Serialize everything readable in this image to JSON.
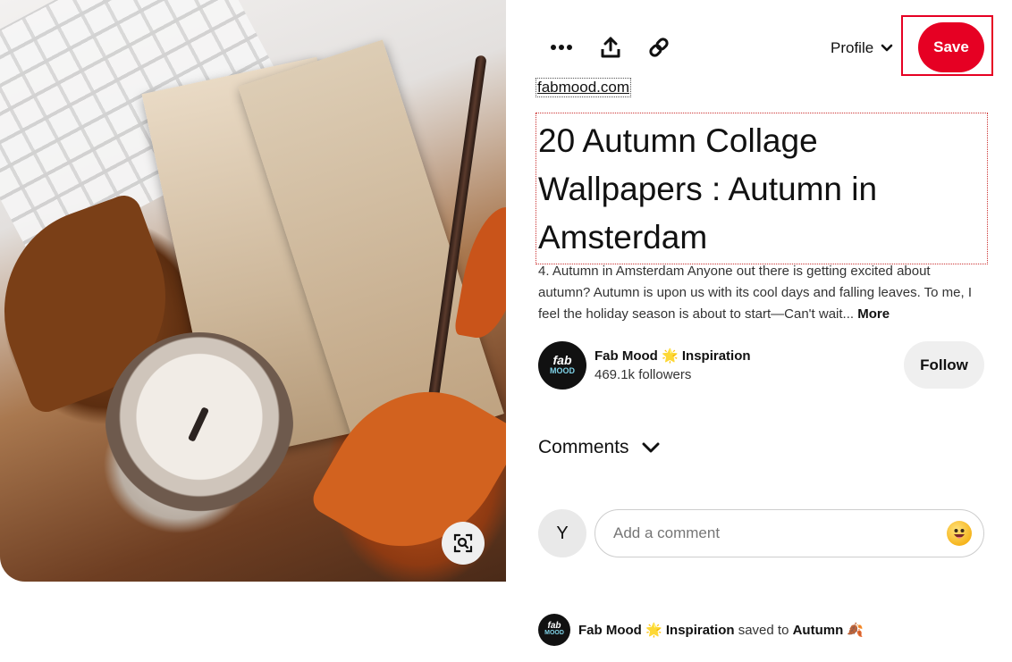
{
  "toolbar": {
    "more_icon": "ellipsis-icon",
    "share_icon": "share-upload-icon",
    "link_icon": "link-icon",
    "profile_label": "Profile",
    "save_label": "Save"
  },
  "pin": {
    "source": "fabmood.com",
    "title": "20 Autumn Collage Wallpapers : Autumn in Amsterdam",
    "description": "4. Autumn in Amsterdam Anyone out there is getting excited about autumn? Autumn is upon us with its cool days and falling leaves. To me, I feel the holiday season is about to start—Can't wait...",
    "more_label": "More"
  },
  "creator": {
    "avatar_text_top": "fab",
    "avatar_text_bottom": "MOOD",
    "name_part1": "Fab Mood",
    "name_emoji": "🌟",
    "name_part2": "Inspiration",
    "followers": "469.1k followers",
    "follow_label": "Follow"
  },
  "comments": {
    "header": "Comments",
    "user_initial": "Y",
    "placeholder": "Add a comment"
  },
  "saved": {
    "name_part1": "Fab Mood",
    "name_emoji": "🌟",
    "name_part2": "Inspiration",
    "middle": "saved to",
    "board": "Autumn",
    "board_emoji": "🍂"
  },
  "colors": {
    "brand_red": "#e60023",
    "chip_gray": "#efefef"
  }
}
